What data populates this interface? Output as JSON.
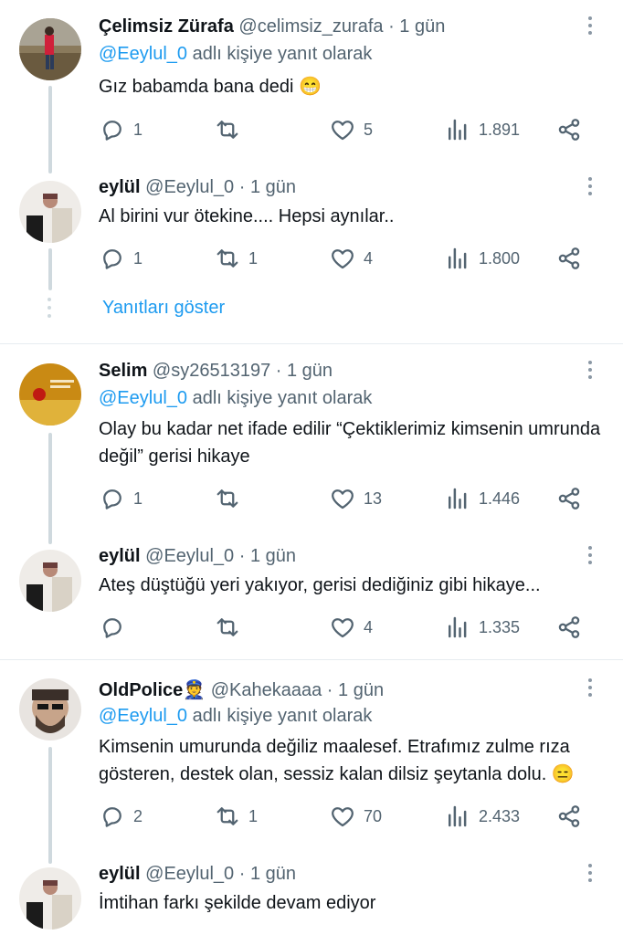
{
  "tweets": [
    {
      "name": "Çelimsiz Zürafa",
      "handle": "@celimsiz_zurafa",
      "time": "· 1 gün",
      "reply_handle": "@Eeylul_0",
      "reply_suffix": " adlı kişiye yanıt olarak",
      "text": "Gız babamda bana dedi 😁",
      "replies": "1",
      "retweets": "",
      "likes": "5",
      "views": "1.891"
    },
    {
      "name": "eylül",
      "handle": "@Eeylul_0",
      "time": "· 1 gün",
      "text": "Al birini vur ötekine.... Hepsi aynılar..",
      "replies": "1",
      "retweets": "1",
      "likes": "4",
      "views": "1.800"
    },
    {
      "name": "Selim",
      "handle": "@sy26513197",
      "time": "· 1 gün",
      "reply_handle": "@Eeylul_0",
      "reply_suffix": " adlı kişiye yanıt olarak",
      "text": "Olay bu kadar net ifade edilir “Çektiklerimiz kimsenin umrunda değil” gerisi hikaye",
      "replies": "1",
      "retweets": "",
      "likes": "13",
      "views": "1.446"
    },
    {
      "name": "eylül",
      "handle": "@Eeylul_0",
      "time": "· 1 gün",
      "text": "Ateş düştüğü yeri yakıyor, gerisi dediğiniz gibi hikaye...",
      "replies": "",
      "retweets": "",
      "likes": "4",
      "views": "1.335"
    },
    {
      "name": "OldPolice👮",
      "handle": "@Kahekaaaa",
      "time": "· 1 gün",
      "reply_handle": "@Eeylul_0",
      "reply_suffix": " adlı kişiye yanıt olarak",
      "text": "Kimsenin umurunda değiliz maalesef. Etrafımız zulme rıza gösteren, destek olan, sessiz kalan dilsiz şeytanla dolu. 😑",
      "replies": "2",
      "retweets": "1",
      "likes": "70",
      "views": "2.433"
    },
    {
      "name": "eylül",
      "handle": "@Eeylul_0",
      "time": "· 1 gün",
      "text": "İmtihan farkı şekilde devam ediyor"
    }
  ],
  "show_replies_label": "Yanıtları göster",
  "icons": [
    "reply-icon",
    "retweet-icon",
    "like-icon",
    "views-icon",
    "share-icon",
    "more-icon"
  ],
  "colors": {
    "link": "#1d9bf0",
    "meta": "#536471",
    "line": "#cfd9de"
  }
}
